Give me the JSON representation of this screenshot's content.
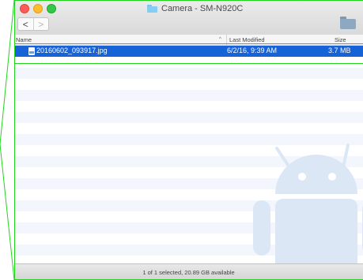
{
  "window": {
    "title": "Camera - SM-N920C",
    "back_glyph": "<",
    "forward_glyph": ">"
  },
  "columns": {
    "name": "Name",
    "sort_indicator": "^",
    "last_modified": "Last Modified",
    "size": "Size"
  },
  "files": [
    {
      "name": "20160602_093917.jpg",
      "last_modified": "6/2/16, 9:39 AM",
      "size": "3.7 MB",
      "selected": true
    }
  ],
  "status": {
    "text": "1 of 1 selected, 20.89 GB available"
  },
  "colors": {
    "selection": "#1563d7",
    "row_stripe": "#f3f7fd",
    "annotation": "#22d41e",
    "android_watermark": "#dbe7f5"
  },
  "icons": {
    "title_folder": "folder-icon",
    "new_folder": "new-folder-icon",
    "file": "image-file-icon",
    "watermark": "android-logo"
  }
}
